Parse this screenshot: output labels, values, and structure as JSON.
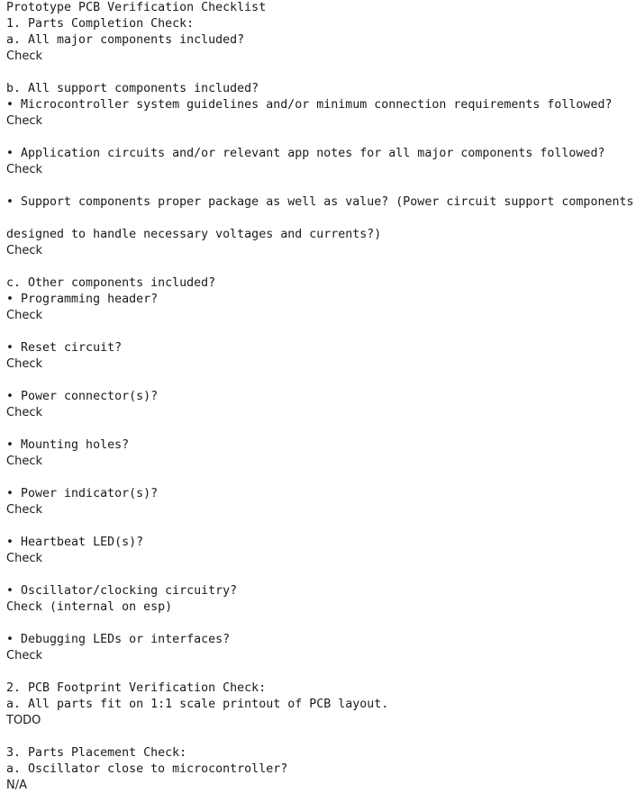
{
  "document": {
    "lines": [
      {
        "text": "Prototype PCB Verification Checklist",
        "kind": "text"
      },
      {
        "text": "1. Parts Completion Check:",
        "kind": "text"
      },
      {
        "text": "a. All major components included?",
        "kind": "text"
      },
      {
        "text": "Check",
        "kind": "status"
      },
      {
        "text": "",
        "kind": "blank"
      },
      {
        "text": "b. All support components included?",
        "kind": "text"
      },
      {
        "text": "• Microcontroller system guidelines and/or minimum connection requirements followed?",
        "kind": "text"
      },
      {
        "text": "Check",
        "kind": "status"
      },
      {
        "text": "",
        "kind": "blank"
      },
      {
        "text": "• Application circuits and/or relevant app notes for all major components followed?",
        "kind": "text"
      },
      {
        "text": "Check",
        "kind": "status"
      },
      {
        "text": "",
        "kind": "blank"
      },
      {
        "text": "• Support components proper package as well as value? (Power circuit support components",
        "kind": "text"
      },
      {
        "text": "",
        "kind": "blank"
      },
      {
        "text": "designed to handle necessary voltages and currents?)",
        "kind": "text"
      },
      {
        "text": "Check",
        "kind": "status"
      },
      {
        "text": "",
        "kind": "blank"
      },
      {
        "text": "c. Other components included?",
        "kind": "text"
      },
      {
        "text": "• Programming header?",
        "kind": "text"
      },
      {
        "text": "Check",
        "kind": "status"
      },
      {
        "text": "",
        "kind": "blank"
      },
      {
        "text": "• Reset circuit?",
        "kind": "text"
      },
      {
        "text": "Check",
        "kind": "status"
      },
      {
        "text": "",
        "kind": "blank"
      },
      {
        "text": "• Power connector(s)?",
        "kind": "text"
      },
      {
        "text": "Check",
        "kind": "status"
      },
      {
        "text": "",
        "kind": "blank"
      },
      {
        "text": "• Mounting holes?",
        "kind": "text"
      },
      {
        "text": "Check",
        "kind": "status"
      },
      {
        "text": "",
        "kind": "blank"
      },
      {
        "text": "• Power indicator(s)?",
        "kind": "text"
      },
      {
        "text": "Check",
        "kind": "status"
      },
      {
        "text": "",
        "kind": "blank"
      },
      {
        "text": "• Heartbeat LED(s)?",
        "kind": "text"
      },
      {
        "text": "Check",
        "kind": "status"
      },
      {
        "text": "",
        "kind": "blank"
      },
      {
        "text": "• Oscillator/clocking circuitry?",
        "kind": "text"
      },
      {
        "text": "Check (internal on esp)",
        "kind": "text"
      },
      {
        "text": "",
        "kind": "blank"
      },
      {
        "text": "• Debugging LEDs or interfaces?",
        "kind": "text"
      },
      {
        "text": "Check",
        "kind": "status"
      },
      {
        "text": "",
        "kind": "blank"
      },
      {
        "text": "2. PCB Footprint Verification Check:",
        "kind": "text"
      },
      {
        "text": "a. All parts fit on 1:1 scale printout of PCB layout.",
        "kind": "text"
      },
      {
        "text": "TODO",
        "kind": "status"
      },
      {
        "text": "",
        "kind": "blank"
      },
      {
        "text": "3. Parts Placement Check:",
        "kind": "text"
      },
      {
        "text": "a. Oscillator close to microcontroller?",
        "kind": "text"
      },
      {
        "text": "N/A",
        "kind": "status"
      }
    ]
  }
}
